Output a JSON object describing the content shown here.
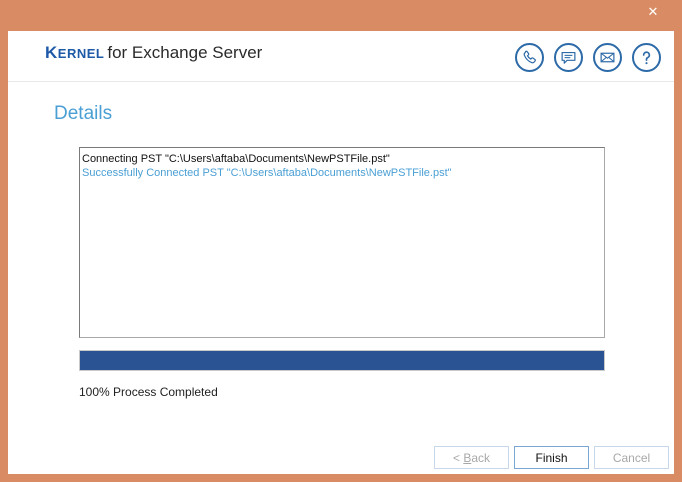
{
  "window": {
    "close_glyph": "✕"
  },
  "header": {
    "brand_kernel_first": "K",
    "brand_kernel_rest": "ERNEL",
    "brand_product": "for Exchange Server",
    "icons": [
      "phone-icon",
      "chat-icon",
      "mail-icon",
      "help-icon"
    ]
  },
  "main": {
    "title": "Details",
    "log": [
      "Connecting PST \"C:\\Users\\aftaba\\Documents\\NewPSTFile.pst\"",
      "Successfully Connected PST \"C:\\Users\\aftaba\\Documents\\NewPSTFile.pst\""
    ],
    "progress_percent": 100,
    "status": "100% Process Completed"
  },
  "footer": {
    "back_prefix": "< ",
    "back_underlined": "B",
    "back_rest": "ack",
    "finish_label": "Finish",
    "cancel_label": "Cancel"
  },
  "colors": {
    "frame": "#d98b63",
    "accent": "#4a9fd4",
    "brand": "#1e5aa8",
    "progress": "#2a5393"
  }
}
